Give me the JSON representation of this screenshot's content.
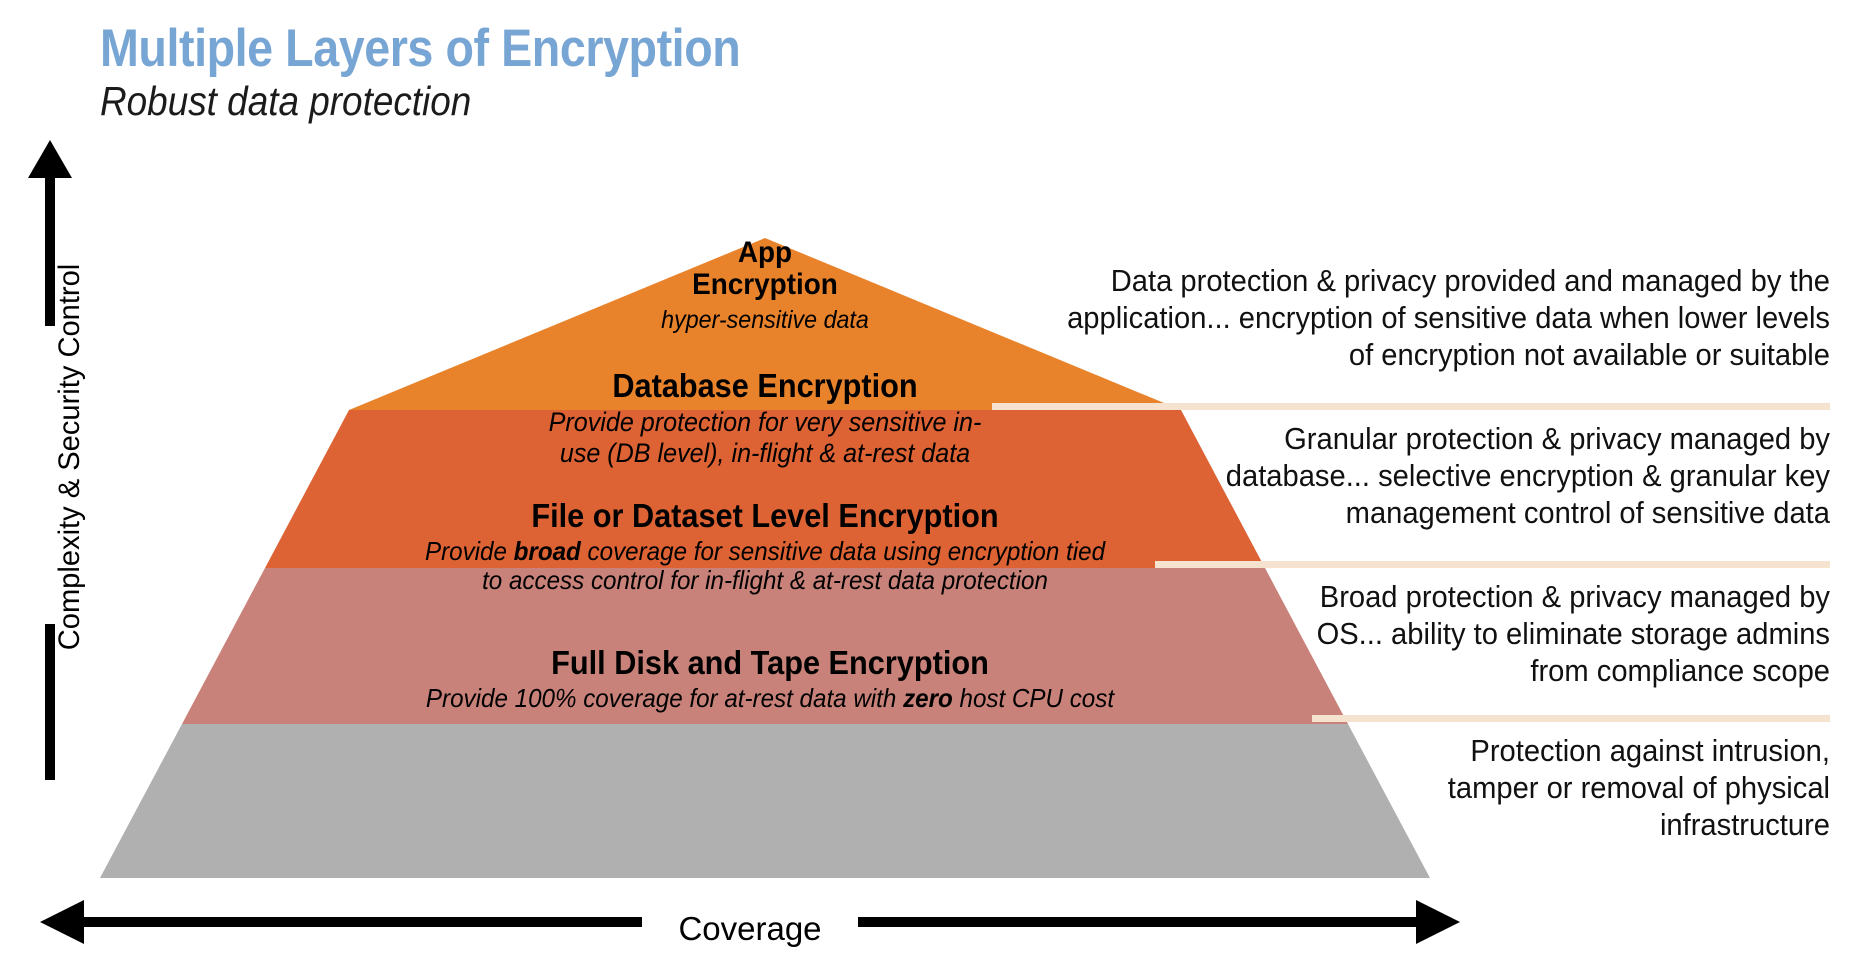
{
  "header": {
    "title": "Multiple Layers of Encryption",
    "subtitle": "Robust data protection",
    "title_color": "#77a5d4"
  },
  "axes": {
    "y_label": "Complexity & Security Control",
    "x_label": "Coverage",
    "y_direction": "up",
    "x_direction": "both"
  },
  "chart_data": {
    "type": "pyramid",
    "title": "Multiple Layers of Encryption",
    "subtitle": "Robust data protection",
    "xlabel": "Coverage",
    "ylabel": "Complexity & Security Control",
    "levels": [
      {
        "rank": 1,
        "name": "App Encryption",
        "detail": "hyper-sensitive data",
        "color": "#e8832c",
        "description": "Data protection & privacy provided and managed by the application... encryption of sensitive data when lower levels of encryption not available or suitable"
      },
      {
        "rank": 2,
        "name": "Database Encryption",
        "detail": "Provide protection for very sensitive in-use (DB level), in-flight & at-rest data",
        "color": "#dd6334",
        "description": "Granular protection & privacy managed by database... selective encryption & granular key management control of sensitive data"
      },
      {
        "rank": 3,
        "name": "File or Dataset Level Encryption",
        "detail": "Provide broad coverage for sensitive data using encryption tied to access control for in-flight & at-rest data protection",
        "color": "#c98279",
        "description": "Broad protection & privacy managed by OS... ability to eliminate storage admins from compliance scope"
      },
      {
        "rank": 4,
        "name": "Full Disk and Tape Encryption",
        "detail": "Provide 100% coverage for at-rest data with zero host CPU cost",
        "color": "#b0b0b0",
        "description": "Protection against intrusion, tamper or removal of physical infrastructure"
      }
    ],
    "separator_color": "#f5e3d0"
  },
  "pyramid": {
    "tier1": {
      "title": "App",
      "title2": "Encryption",
      "sub": "hyper-sensitive data"
    },
    "tier2": {
      "title": "Database Encryption",
      "sub_line1": "Provide protection for very sensitive in-",
      "sub_line2": "use (DB level), in-flight & at-rest data"
    },
    "tier3": {
      "title": "File or Dataset Level Encryption",
      "sub_pre": "Provide ",
      "sub_bold": "broad",
      "sub_post": " coverage for sensitive data using encryption tied",
      "sub_line2": "to access control for in-flight & at-rest data protection"
    },
    "tier4": {
      "title": "Full Disk and Tape Encryption",
      "sub_pre": "Provide 100% coverage for at-rest data with ",
      "sub_bold": "zero",
      "sub_post": " host CPU cost"
    }
  },
  "descriptions": {
    "d1": "Data protection & privacy provided and managed by the application... encryption of sensitive data when lower levels of encryption not available or suitable",
    "d2": "Granular protection & privacy managed by database... selective encryption & granular key management control of sensitive data",
    "d3": "Broad protection & privacy managed by OS... ability to eliminate storage admins from compliance scope",
    "d4": "Protection against intrusion, tamper or removal of physical infrastructure"
  }
}
